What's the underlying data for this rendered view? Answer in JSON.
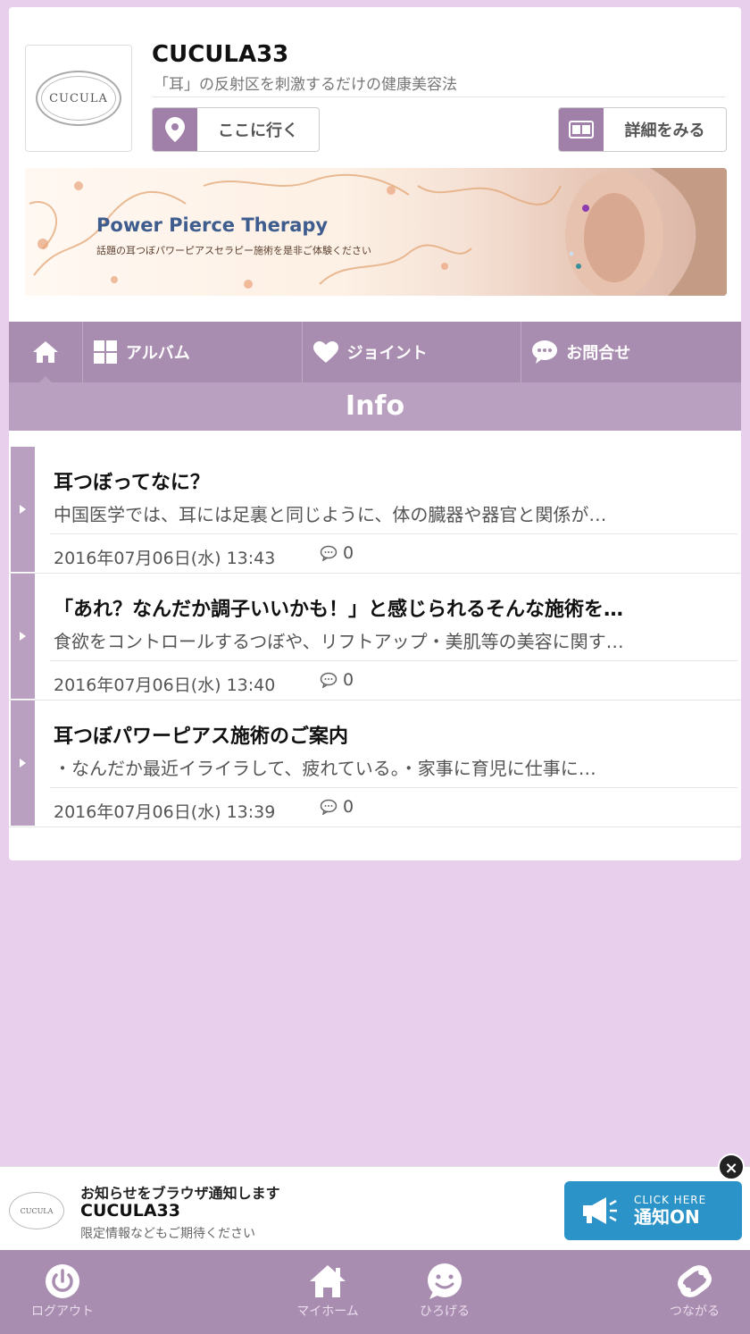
{
  "header": {
    "logo_text": "CUCULA",
    "shop_name": "CUCULA33",
    "tagline": "「耳」の反射区を刺激するだけの健康美容法",
    "go_button": "ここに行く",
    "detail_button": "詳細をみる"
  },
  "banner": {
    "title": "Power Pierce Therapy",
    "subtitle": "話題の耳つぼパワーピアスセラピー施術を是非ご体験ください"
  },
  "nav": {
    "album": "アルバム",
    "joint": "ジョイント",
    "contact": "お問合せ"
  },
  "section_title": "Info",
  "posts": [
    {
      "title": "耳つぼってなに？",
      "body": "中国医学では、耳には足裏と同じように、体の臓器や器官と関係が…",
      "date": "2016年07月06日(水) 13:43",
      "comments": "0"
    },
    {
      "title": "「あれ？なんだか調子いいかも！」と感じられるそんな施術を…",
      "body": "食欲をコントロールするつぼや、リフトアップ・美肌等の美容に関す…",
      "date": "2016年07月06日(水) 13:40",
      "comments": "0"
    },
    {
      "title": "耳つぼパワーピアス施術のご案内",
      "body": "・なんだか最近イライラして、疲れている。・家事に育児に仕事に…",
      "date": "2016年07月06日(水) 13:39",
      "comments": "0"
    }
  ],
  "notification": {
    "line1": "お知らせをブラウザ通知します",
    "line2": "CUCULA33",
    "line3": "限定情報などもご期待ください",
    "logo_text": "CUCULA",
    "button_small": "CLICK HERE",
    "button_big": "通知ON"
  },
  "tabbar": {
    "logout": "ログアウト",
    "home": "マイホーム",
    "spread": "ひろげる",
    "connect": "つながる"
  },
  "colors": {
    "background": "#e8d0ec",
    "nav": "#a98db0",
    "accent": "#b99fc0",
    "notify_button": "#2b93c7"
  }
}
